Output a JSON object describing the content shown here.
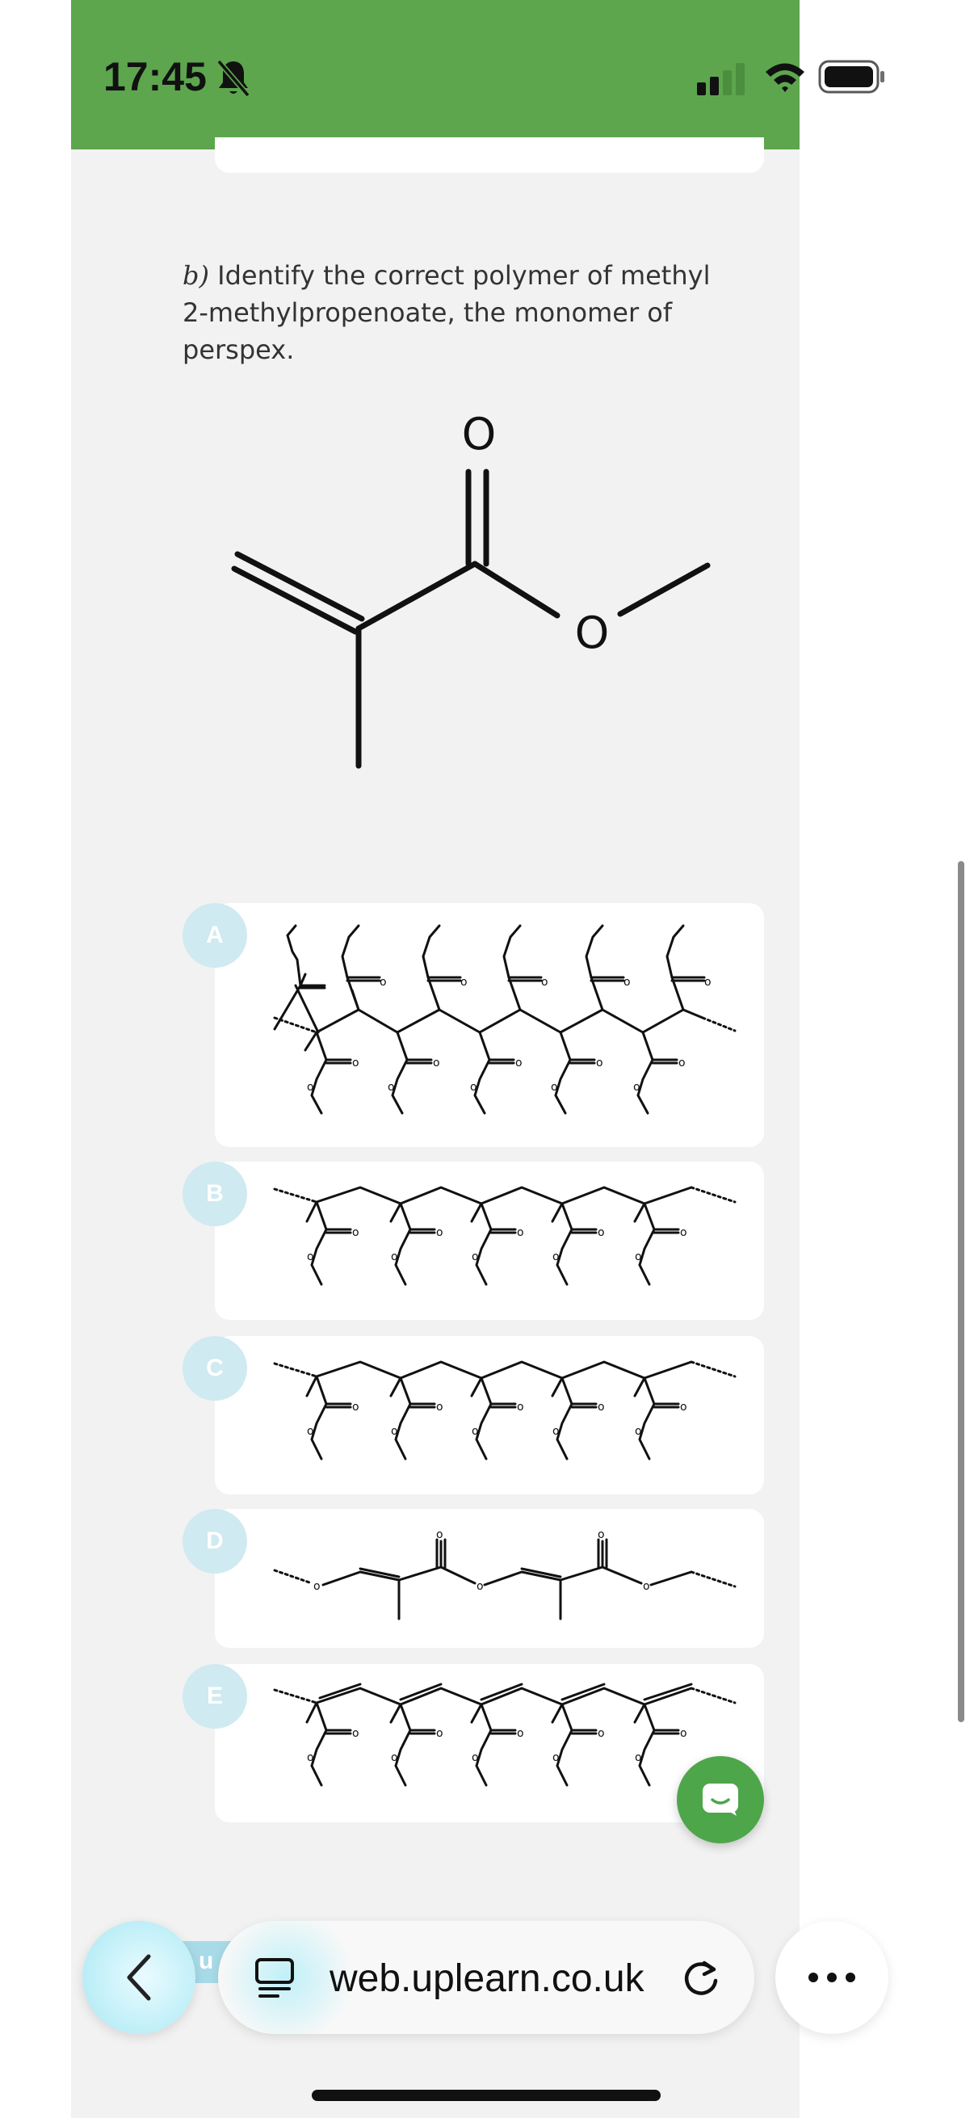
{
  "status_bar": {
    "time": "17:45",
    "bar_color": "#5da64e",
    "icons": [
      "bell-slash-icon",
      "cellular-signal-icon",
      "wifi-icon",
      "battery-icon"
    ]
  },
  "question": {
    "label": "b)",
    "text": "Identify the correct polymer of methyl 2-methylpropenoate, the monomer of perspex."
  },
  "structure_labels": {
    "oxygen": "O",
    "small_oxygen": "o"
  },
  "options": [
    {
      "letter": "A"
    },
    {
      "letter": "B"
    },
    {
      "letter": "C"
    },
    {
      "letter": "D"
    },
    {
      "letter": "E"
    }
  ],
  "browser": {
    "url": "web.uplearn.co.uk",
    "strip_text": "u",
    "icons": [
      "back-chevron-icon",
      "tab-overview-icon",
      "reload-icon",
      "more-dots-icon",
      "chat-icon"
    ]
  },
  "colors": {
    "accent_green": "#5da64e",
    "badge": "#cfeaf1",
    "page_bg": "#f2f2f2"
  }
}
